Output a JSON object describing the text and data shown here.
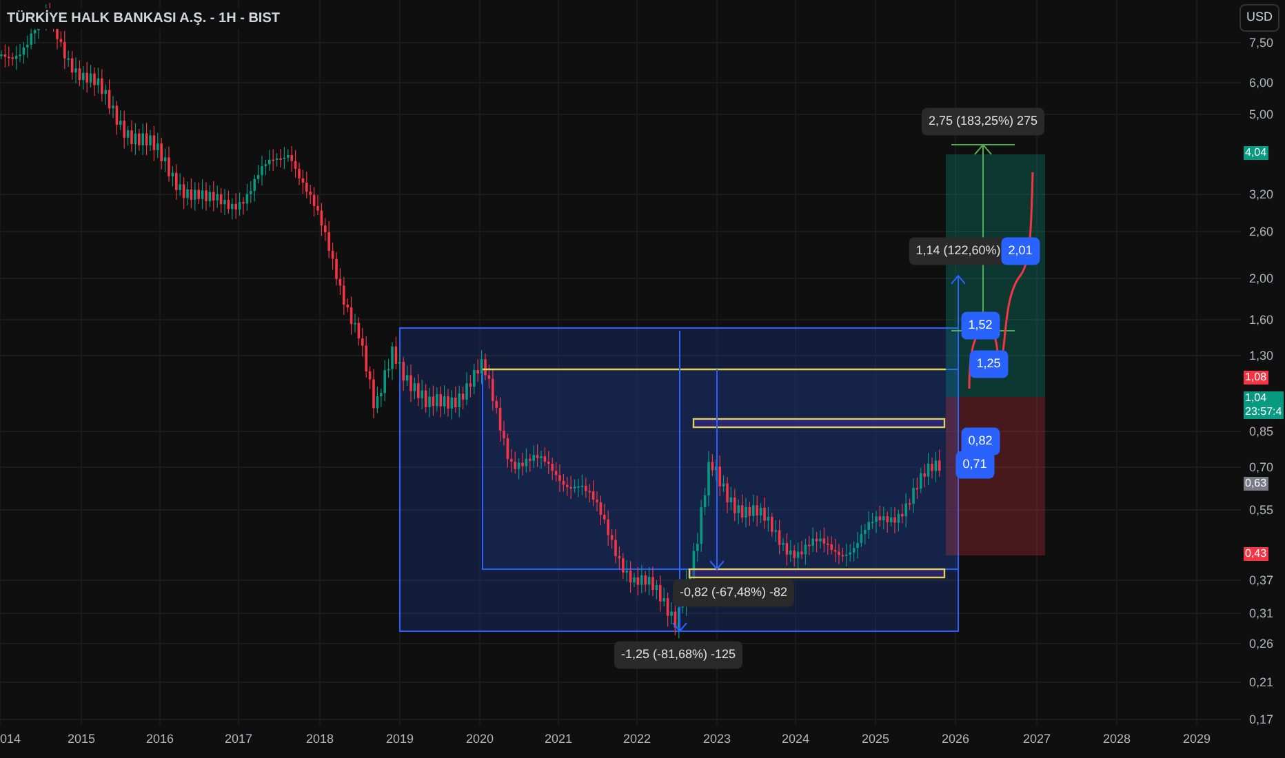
{
  "title": "TÜRKİYE HALK BANKASI A.Ş. - 1H - BIST",
  "currency": "USD",
  "y_axis": [
    "7,50",
    "6,00",
    "5,00",
    "3,20",
    "2,60",
    "2,00",
    "1,60",
    "1,30",
    "0,85",
    "0,70",
    "0,55",
    "0,37",
    "0,31",
    "0,26",
    "0,21",
    "0,17"
  ],
  "price_tags": [
    {
      "label": "4,04",
      "color": "#089981"
    },
    {
      "label": "1,08",
      "color": "#f23645"
    },
    {
      "label": "1,04",
      "sub": "23:57:4",
      "color": "#089981"
    },
    {
      "label": "0,63",
      "color": "#787b86"
    },
    {
      "label": "0,43",
      "color": "#f23645"
    }
  ],
  "x_axis": [
    "014",
    "2015",
    "2016",
    "2017",
    "2018",
    "2019",
    "2020",
    "2021",
    "2022",
    "2023",
    "2024",
    "2025",
    "2026",
    "2027",
    "2028",
    "2029"
  ],
  "measurements": [
    "2,75 (183,25%) 275",
    "1,14 (122,60%)",
    "-0,82 (-67,48%) -82",
    "-1,25 (-81,68%) -125"
  ],
  "badges": [
    "2,01",
    "1,52",
    "1,25",
    "0,82",
    "0,71"
  ]
}
